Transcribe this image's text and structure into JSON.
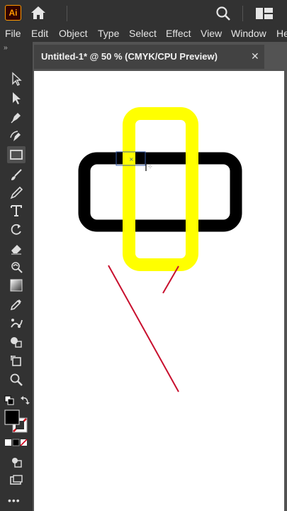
{
  "app": {
    "logo_text": "Ai",
    "brand_color": "#ff9a00"
  },
  "icons": {
    "home": "home-icon",
    "search": "search-icon",
    "arrange": "arrange-documents-icon"
  },
  "menu": {
    "items": [
      "File",
      "Edit",
      "Object",
      "Type",
      "Select",
      "Effect",
      "View",
      "Window",
      "He"
    ]
  },
  "document": {
    "tab_title": "Untitled-1* @ 50 % (CMYK/CPU Preview)",
    "close_label": "✕"
  },
  "toolbar": {
    "collapse_label": "››",
    "tools": [
      "selection-tool",
      "direct-selection-tool",
      "pen-tool",
      "curvature-tool",
      "rectangle-tool",
      "paintbrush-tool",
      "pencil-tool",
      "type-tool",
      "rotate-tool",
      "eraser-tool",
      "warp-tool",
      "gradient-tool",
      "eyedropper-tool",
      "puppet-warp-tool",
      "shape-builder-tool",
      "artboard-tool",
      "zoom-tool",
      "fill-stroke-swatches",
      "color-mode-buttons",
      "screen-mode-button",
      "edit-toolbar-button"
    ],
    "active_tool": "rectangle-tool",
    "more_label": "•••"
  },
  "colors": {
    "yellow_stroke": "#ffff00",
    "black_stroke": "#000000",
    "red_line": "#c8102e",
    "selection_blue": "#3a5ca8",
    "fill_swatch": "#000000"
  }
}
